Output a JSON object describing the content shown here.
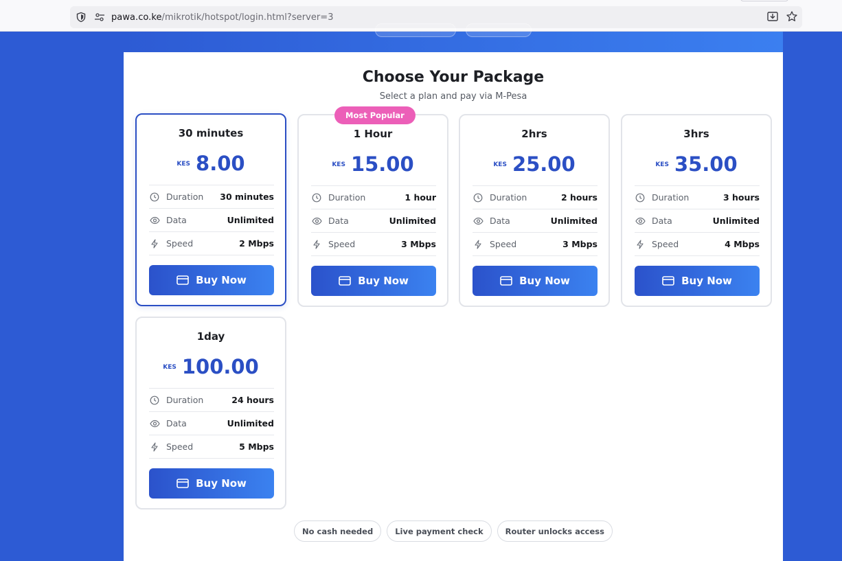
{
  "browser": {
    "url_host": "pawa.co.ke",
    "url_path": "/mikrotik/hotspot/login.html?server=3"
  },
  "page": {
    "title": "Choose Your Package",
    "subtitle": "Select a plan and pay via M-Pesa",
    "popular_badge": "Most Popular",
    "labels": {
      "duration": "Duration",
      "data": "Data",
      "speed": "Speed",
      "buy": "Buy Now"
    },
    "packages": [
      {
        "name": "30 minutes",
        "currency": "KES",
        "price": "8.00",
        "duration": "30 minutes",
        "data": "Unlimited",
        "speed": "2 Mbps"
      },
      {
        "name": "1 Hour",
        "currency": "KES",
        "price": "15.00",
        "duration": "1 hour",
        "data": "Unlimited",
        "speed": "3 Mbps"
      },
      {
        "name": "2hrs",
        "currency": "KES",
        "price": "25.00",
        "duration": "2 hours",
        "data": "Unlimited",
        "speed": "3 Mbps"
      },
      {
        "name": "3hrs",
        "currency": "KES",
        "price": "35.00",
        "duration": "3 hours",
        "data": "Unlimited",
        "speed": "4 Mbps"
      },
      {
        "name": "1day",
        "currency": "KES",
        "price": "100.00",
        "duration": "24 hours",
        "data": "Unlimited",
        "speed": "5 Mbps"
      }
    ],
    "chips": [
      "No cash needed",
      "Live payment check",
      "Router unlocks access"
    ]
  },
  "colors": {
    "accent": "#2b4fc4",
    "badge": "#ec5fb8",
    "background": "#2d5bd4"
  }
}
